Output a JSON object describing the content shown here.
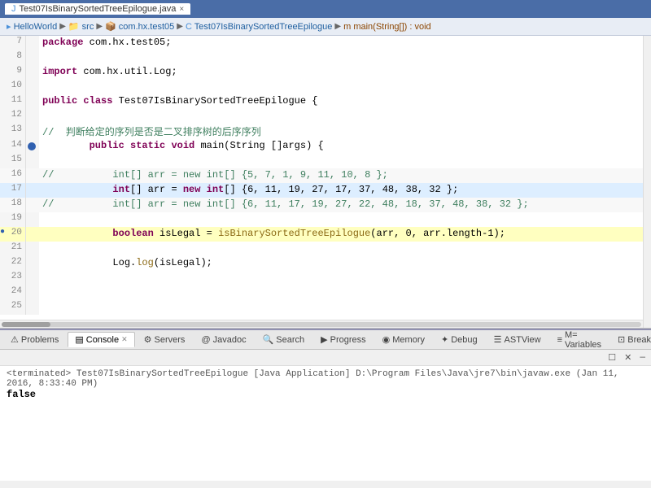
{
  "titleBar": {
    "tab": "Test07IsBinarySortedTreeEpilogue.java",
    "closeIcon": "×"
  },
  "breadcrumb": {
    "items": [
      {
        "label": "HelloWorld",
        "type": "project"
      },
      {
        "label": "src",
        "type": "folder"
      },
      {
        "label": "com.hx.test05",
        "type": "package"
      },
      {
        "label": "Test07IsBinarySortedTreeEpilogue",
        "type": "class"
      },
      {
        "label": "main(String[]) : void",
        "type": "method"
      }
    ]
  },
  "codeLines": [
    {
      "num": "7",
      "content": "package com.hx.test05;",
      "type": "normal"
    },
    {
      "num": "8",
      "content": "",
      "type": "normal"
    },
    {
      "num": "9",
      "content": "import com.hx.util.Log;",
      "type": "normal"
    },
    {
      "num": "10",
      "content": "",
      "type": "normal"
    },
    {
      "num": "11",
      "content": "public class Test07IsBinarySortedTreeEpilogue {",
      "type": "normal"
    },
    {
      "num": "12",
      "content": "",
      "type": "normal"
    },
    {
      "num": "13",
      "content": "        //  判断给定的序列是否是二叉排序树的后序序列",
      "type": "normal"
    },
    {
      "num": "14",
      "content": "        public static void main(String []args) {",
      "type": "normal"
    },
    {
      "num": "15",
      "content": "",
      "type": "normal"
    },
    {
      "num": "16",
      "content": "//          int[] arr = new int[] {5, 7, 1, 9, 11, 10, 8 };",
      "type": "commented"
    },
    {
      "num": "17",
      "content": "            int[] arr = new int[] {6, 11, 19, 27, 17, 37, 48, 38, 32 };",
      "type": "highlighted"
    },
    {
      "num": "18",
      "content": "//          int[] arr = new int[] {6, 11, 17, 19, 27, 22, 48, 18, 37, 48, 38, 32 };",
      "type": "commented"
    },
    {
      "num": "19",
      "content": "",
      "type": "normal"
    },
    {
      "num": "20",
      "content": "            boolean isLegal = isBinarySortedTreeEpilogue(arr, 0, arr.length-1);",
      "type": "debug"
    },
    {
      "num": "21",
      "content": "",
      "type": "normal"
    },
    {
      "num": "22",
      "content": "            Log.log(isLegal);",
      "type": "normal"
    },
    {
      "num": "23",
      "content": "",
      "type": "normal"
    },
    {
      "num": "24",
      "content": "",
      "type": "normal"
    },
    {
      "num": "25",
      "content": "",
      "type": "normal"
    }
  ],
  "bottomTabs": [
    {
      "label": "Problems",
      "icon": "⚠",
      "active": false
    },
    {
      "label": "Console",
      "icon": "▤",
      "active": true
    },
    {
      "label": "Servers",
      "icon": "⚙",
      "active": false
    },
    {
      "label": "Javadoc",
      "icon": "@",
      "active": false
    },
    {
      "label": "Search",
      "icon": "🔍",
      "active": false
    },
    {
      "label": "Progress",
      "icon": "▶",
      "active": false
    },
    {
      "label": "Memory",
      "icon": "◉",
      "active": false
    },
    {
      "label": "Debug",
      "icon": "🐛",
      "active": false
    },
    {
      "label": "ASTView",
      "icon": "☰",
      "active": false
    },
    {
      "label": "Variables",
      "icon": "≡",
      "active": false
    },
    {
      "label": "Break",
      "icon": "⊡",
      "active": false
    }
  ],
  "consoleToolbar": {
    "clearBtn": "✕",
    "closeBtn": "✕",
    "minimizeBtn": "—"
  },
  "consoleOutput": {
    "terminated": "<terminated> Test07IsBinarySortedTreeEpilogue [Java Application] D:\\Program Files\\Java\\jre7\\bin\\javaw.exe (Jan 11, 2016, 8:33:40 PM)",
    "result": "false"
  }
}
